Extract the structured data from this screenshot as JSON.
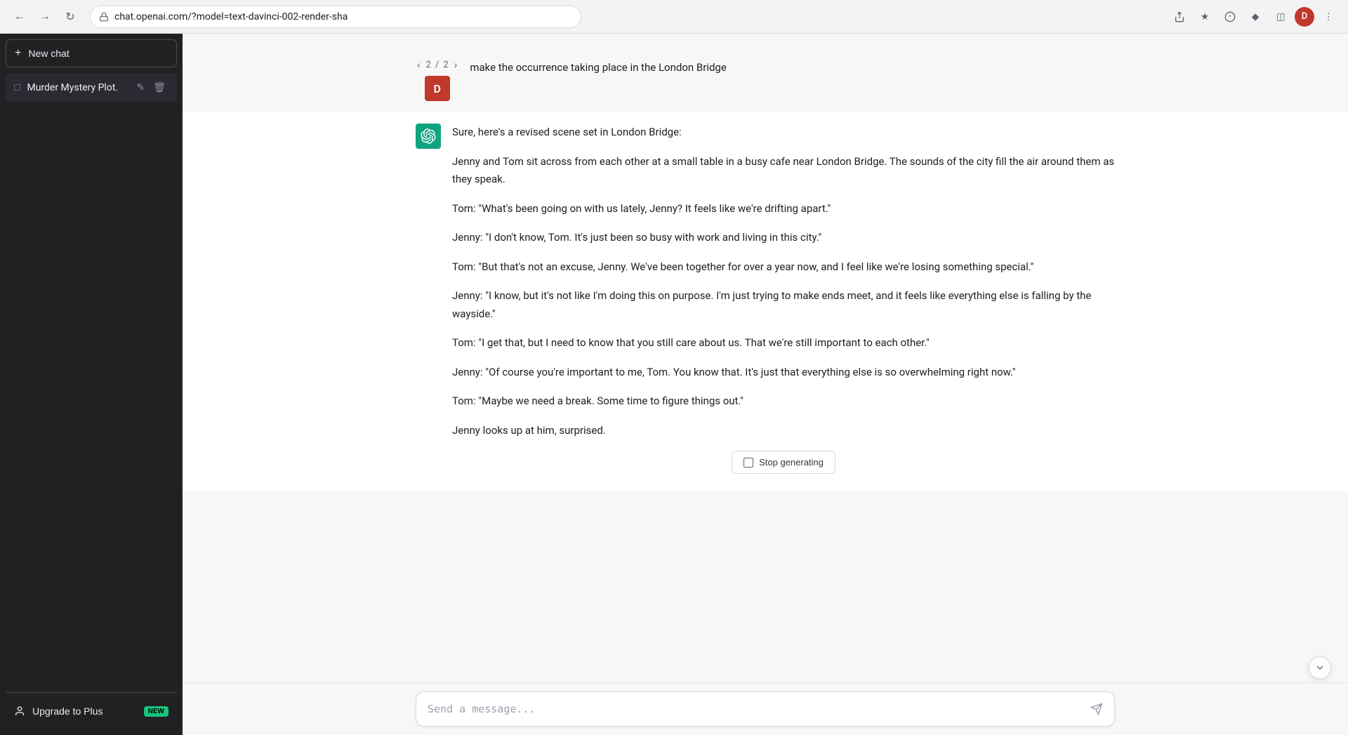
{
  "browser": {
    "url": "chat.openai.com/?model=text-davinci-002-render-sha",
    "back_disabled": false,
    "forward_disabled": false,
    "user_initial": "D"
  },
  "sidebar": {
    "new_chat_label": "New chat",
    "chat_items": [
      {
        "id": "murder-mystery",
        "label": "Murder Mystery Plot.",
        "active": true
      }
    ],
    "upgrade_label": "Upgrade to Plus",
    "new_badge": "NEW"
  },
  "chat": {
    "nav": {
      "prev": "‹",
      "current": "2",
      "separator": "/",
      "total": "2",
      "next": "›"
    },
    "user_initial": "D",
    "user_message": "make the occurrence taking place in the London Bridge",
    "ai_response_intro": "Sure, here's a revised scene set in London Bridge:",
    "ai_response_paragraphs": [
      "Jenny and Tom sit across from each other at a small table in a busy cafe near London Bridge. The sounds of the city fill the air around them as they speak.",
      "Tom: \"What's been going on with us lately, Jenny? It feels like we're drifting apart.\"",
      "Jenny: \"I don't know, Tom. It's just been so busy with work and living in this city.\"",
      "Tom: \"But that's not an excuse, Jenny. We've been together for over a year now, and I feel like we're losing something special.\"",
      "Jenny: \"I know, but it's not like I'm doing this on purpose. I'm just trying to make ends meet, and it feels like everything else is falling by the wayside.\"",
      "Tom: \"I get that, but I need to know that you still care about us. That we're still important to each other.\"",
      "Jenny: \"Of course you're important to me, Tom. You know that. It's just that everything else is so overwhelming right now.\"",
      "Tom: \"Maybe we need a break. Some time to figure things out.\"",
      "Jenny looks up at him, surprised."
    ],
    "stop_generating_label": "Stop generating",
    "input_placeholder": "Send a message...",
    "send_icon": "›"
  }
}
